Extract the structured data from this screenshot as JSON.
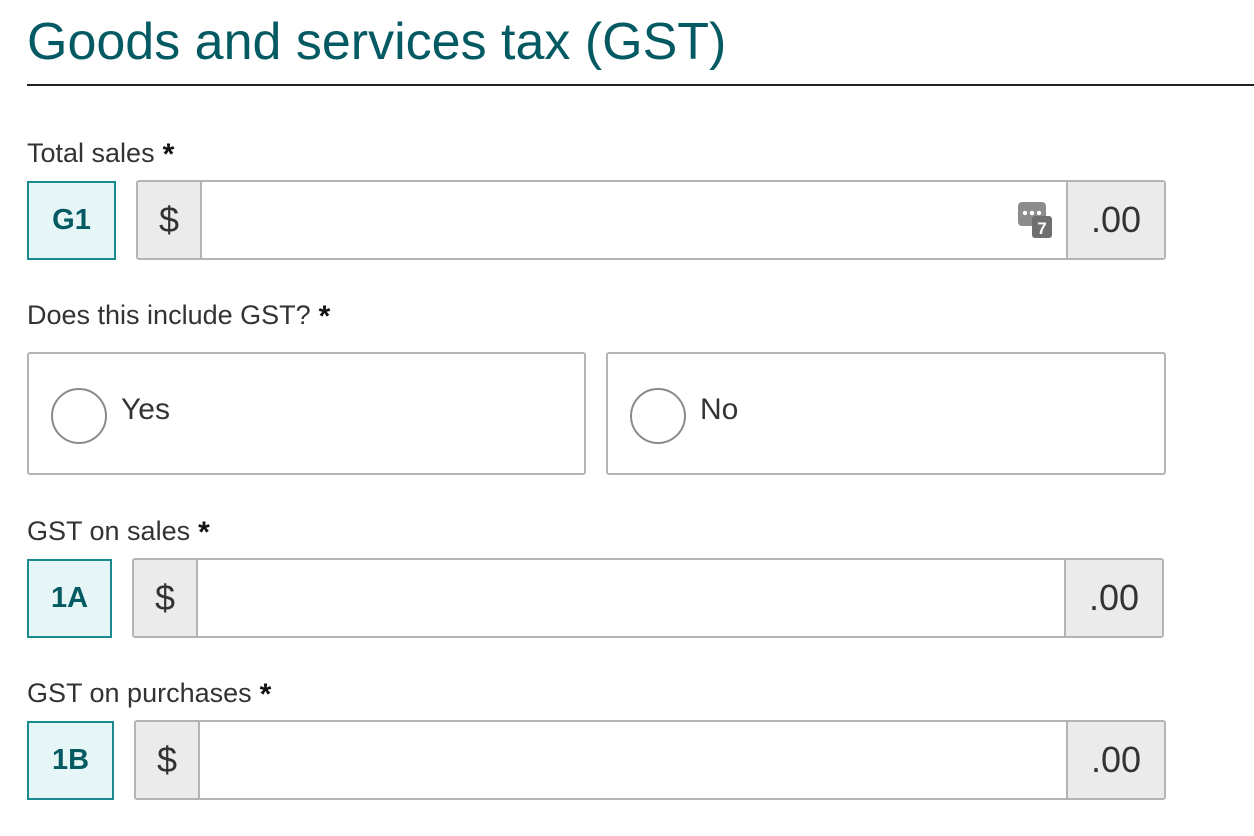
{
  "section": {
    "title": "Goods and services tax (GST)"
  },
  "required_marker": "*",
  "total_sales": {
    "label": "Total sales",
    "code": "G1",
    "currency_symbol": "$",
    "value": "",
    "cents_suffix": ".00",
    "calculator_icon": "calculator-icon",
    "calculator_badge": "7"
  },
  "includes_gst": {
    "question": "Does this include GST?",
    "options": [
      {
        "label": "Yes",
        "selected": false
      },
      {
        "label": "No",
        "selected": false
      }
    ]
  },
  "gst_on_sales": {
    "label": "GST on sales",
    "code": "1A",
    "currency_symbol": "$",
    "value": "",
    "cents_suffix": ".00"
  },
  "gst_on_purchases": {
    "label": "GST on purchases",
    "code": "1B",
    "currency_symbol": "$",
    "value": "",
    "cents_suffix": ".00"
  },
  "colors": {
    "title": "#045a62",
    "code_border": "#1b8a8f",
    "code_background": "#e6f6f6",
    "input_border": "#b4b4b4",
    "addon_background": "#ebebeb"
  }
}
